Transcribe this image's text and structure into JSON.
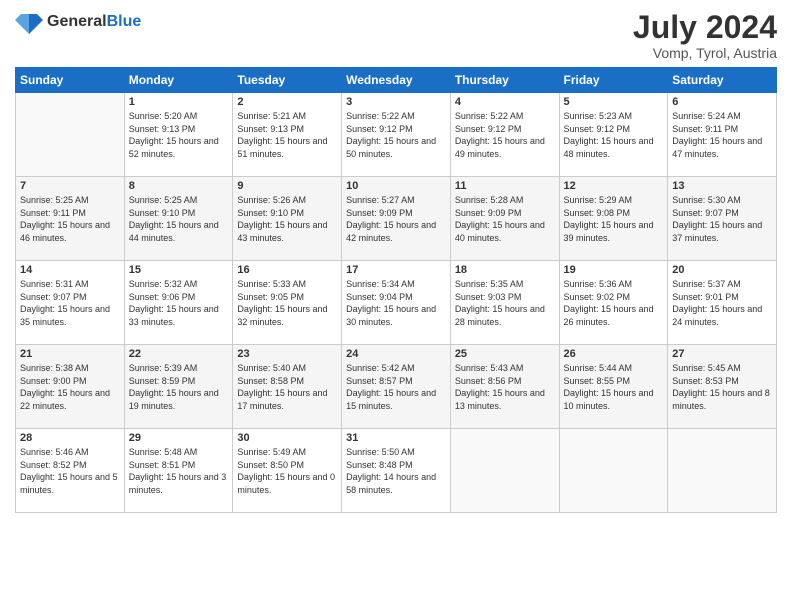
{
  "header": {
    "logo_general": "General",
    "logo_blue": "Blue",
    "month_year": "July 2024",
    "location": "Vomp, Tyrol, Austria"
  },
  "columns": [
    "Sunday",
    "Monday",
    "Tuesday",
    "Wednesday",
    "Thursday",
    "Friday",
    "Saturday"
  ],
  "weeks": [
    [
      {
        "day": "",
        "empty": true
      },
      {
        "day": "1",
        "sunrise": "Sunrise: 5:20 AM",
        "sunset": "Sunset: 9:13 PM",
        "daylight": "Daylight: 15 hours and 52 minutes."
      },
      {
        "day": "2",
        "sunrise": "Sunrise: 5:21 AM",
        "sunset": "Sunset: 9:13 PM",
        "daylight": "Daylight: 15 hours and 51 minutes."
      },
      {
        "day": "3",
        "sunrise": "Sunrise: 5:22 AM",
        "sunset": "Sunset: 9:12 PM",
        "daylight": "Daylight: 15 hours and 50 minutes."
      },
      {
        "day": "4",
        "sunrise": "Sunrise: 5:22 AM",
        "sunset": "Sunset: 9:12 PM",
        "daylight": "Daylight: 15 hours and 49 minutes."
      },
      {
        "day": "5",
        "sunrise": "Sunrise: 5:23 AM",
        "sunset": "Sunset: 9:12 PM",
        "daylight": "Daylight: 15 hours and 48 minutes."
      },
      {
        "day": "6",
        "sunrise": "Sunrise: 5:24 AM",
        "sunset": "Sunset: 9:11 PM",
        "daylight": "Daylight: 15 hours and 47 minutes."
      }
    ],
    [
      {
        "day": "7",
        "sunrise": "Sunrise: 5:25 AM",
        "sunset": "Sunset: 9:11 PM",
        "daylight": "Daylight: 15 hours and 46 minutes."
      },
      {
        "day": "8",
        "sunrise": "Sunrise: 5:25 AM",
        "sunset": "Sunset: 9:10 PM",
        "daylight": "Daylight: 15 hours and 44 minutes."
      },
      {
        "day": "9",
        "sunrise": "Sunrise: 5:26 AM",
        "sunset": "Sunset: 9:10 PM",
        "daylight": "Daylight: 15 hours and 43 minutes."
      },
      {
        "day": "10",
        "sunrise": "Sunrise: 5:27 AM",
        "sunset": "Sunset: 9:09 PM",
        "daylight": "Daylight: 15 hours and 42 minutes."
      },
      {
        "day": "11",
        "sunrise": "Sunrise: 5:28 AM",
        "sunset": "Sunset: 9:09 PM",
        "daylight": "Daylight: 15 hours and 40 minutes."
      },
      {
        "day": "12",
        "sunrise": "Sunrise: 5:29 AM",
        "sunset": "Sunset: 9:08 PM",
        "daylight": "Daylight: 15 hours and 39 minutes."
      },
      {
        "day": "13",
        "sunrise": "Sunrise: 5:30 AM",
        "sunset": "Sunset: 9:07 PM",
        "daylight": "Daylight: 15 hours and 37 minutes."
      }
    ],
    [
      {
        "day": "14",
        "sunrise": "Sunrise: 5:31 AM",
        "sunset": "Sunset: 9:07 PM",
        "daylight": "Daylight: 15 hours and 35 minutes."
      },
      {
        "day": "15",
        "sunrise": "Sunrise: 5:32 AM",
        "sunset": "Sunset: 9:06 PM",
        "daylight": "Daylight: 15 hours and 33 minutes."
      },
      {
        "day": "16",
        "sunrise": "Sunrise: 5:33 AM",
        "sunset": "Sunset: 9:05 PM",
        "daylight": "Daylight: 15 hours and 32 minutes."
      },
      {
        "day": "17",
        "sunrise": "Sunrise: 5:34 AM",
        "sunset": "Sunset: 9:04 PM",
        "daylight": "Daylight: 15 hours and 30 minutes."
      },
      {
        "day": "18",
        "sunrise": "Sunrise: 5:35 AM",
        "sunset": "Sunset: 9:03 PM",
        "daylight": "Daylight: 15 hours and 28 minutes."
      },
      {
        "day": "19",
        "sunrise": "Sunrise: 5:36 AM",
        "sunset": "Sunset: 9:02 PM",
        "daylight": "Daylight: 15 hours and 26 minutes."
      },
      {
        "day": "20",
        "sunrise": "Sunrise: 5:37 AM",
        "sunset": "Sunset: 9:01 PM",
        "daylight": "Daylight: 15 hours and 24 minutes."
      }
    ],
    [
      {
        "day": "21",
        "sunrise": "Sunrise: 5:38 AM",
        "sunset": "Sunset: 9:00 PM",
        "daylight": "Daylight: 15 hours and 22 minutes."
      },
      {
        "day": "22",
        "sunrise": "Sunrise: 5:39 AM",
        "sunset": "Sunset: 8:59 PM",
        "daylight": "Daylight: 15 hours and 19 minutes."
      },
      {
        "day": "23",
        "sunrise": "Sunrise: 5:40 AM",
        "sunset": "Sunset: 8:58 PM",
        "daylight": "Daylight: 15 hours and 17 minutes."
      },
      {
        "day": "24",
        "sunrise": "Sunrise: 5:42 AM",
        "sunset": "Sunset: 8:57 PM",
        "daylight": "Daylight: 15 hours and 15 minutes."
      },
      {
        "day": "25",
        "sunrise": "Sunrise: 5:43 AM",
        "sunset": "Sunset: 8:56 PM",
        "daylight": "Daylight: 15 hours and 13 minutes."
      },
      {
        "day": "26",
        "sunrise": "Sunrise: 5:44 AM",
        "sunset": "Sunset: 8:55 PM",
        "daylight": "Daylight: 15 hours and 10 minutes."
      },
      {
        "day": "27",
        "sunrise": "Sunrise: 5:45 AM",
        "sunset": "Sunset: 8:53 PM",
        "daylight": "Daylight: 15 hours and 8 minutes."
      }
    ],
    [
      {
        "day": "28",
        "sunrise": "Sunrise: 5:46 AM",
        "sunset": "Sunset: 8:52 PM",
        "daylight": "Daylight: 15 hours and 5 minutes."
      },
      {
        "day": "29",
        "sunrise": "Sunrise: 5:48 AM",
        "sunset": "Sunset: 8:51 PM",
        "daylight": "Daylight: 15 hours and 3 minutes."
      },
      {
        "day": "30",
        "sunrise": "Sunrise: 5:49 AM",
        "sunset": "Sunset: 8:50 PM",
        "daylight": "Daylight: 15 hours and 0 minutes."
      },
      {
        "day": "31",
        "sunrise": "Sunrise: 5:50 AM",
        "sunset": "Sunset: 8:48 PM",
        "daylight": "Daylight: 14 hours and 58 minutes."
      },
      {
        "day": "",
        "empty": true
      },
      {
        "day": "",
        "empty": true
      },
      {
        "day": "",
        "empty": true
      }
    ]
  ]
}
